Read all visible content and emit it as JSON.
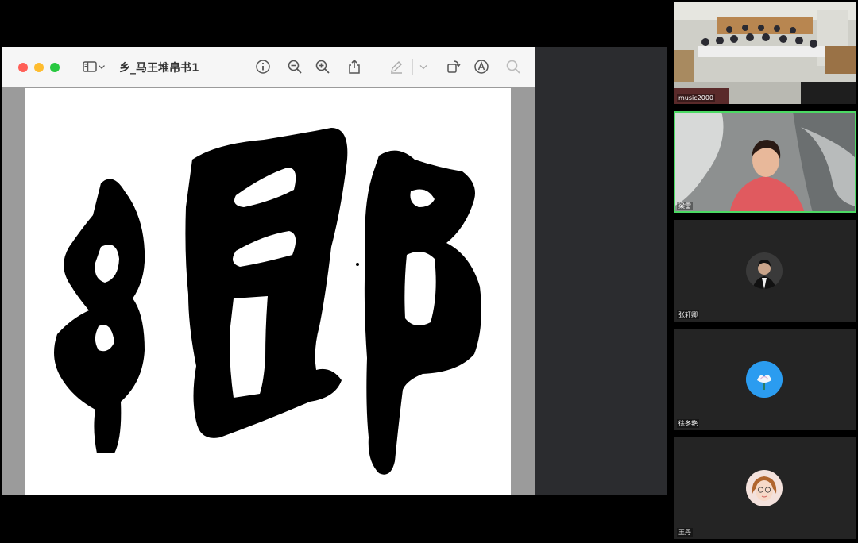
{
  "preview": {
    "title": "乡_马王堆帛书1",
    "toolbar_icons": [
      "sidebar-icon",
      "chevron-down-icon",
      "info-icon",
      "zoom-out-icon",
      "zoom-in-icon",
      "share-icon",
      "markup-pen-icon",
      "chevron-down-icon",
      "rotate-icon",
      "annotate-icon",
      "search-icon"
    ]
  },
  "participants": [
    {
      "name": "music2000",
      "type": "video",
      "active": false
    },
    {
      "name": "梁雷",
      "type": "video",
      "active": true
    },
    {
      "name": "张轩卿",
      "type": "avatar",
      "active": false
    },
    {
      "name": "徐冬艳",
      "type": "avatar",
      "active": false
    },
    {
      "name": "王丹",
      "type": "avatar",
      "active": false
    }
  ],
  "colors": {
    "active_speaker_border": "#4cd964",
    "close": "#ff5f57",
    "minimize": "#febc2e",
    "maximize": "#28c840"
  }
}
